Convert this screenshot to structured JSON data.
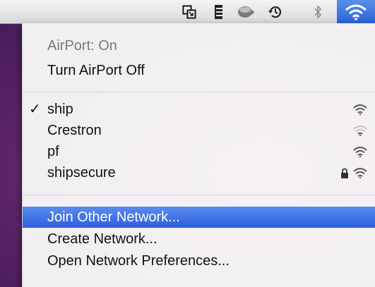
{
  "menubar": {
    "icons": [
      "window-switch-icon",
      "script-icon",
      "coffee-cup-icon",
      "time-machine-icon",
      "bluetooth-icon",
      "wifi-icon"
    ]
  },
  "menu": {
    "status": "AirPort: On",
    "toggle": "Turn AirPort Off",
    "networks": [
      {
        "name": "ship",
        "checked": true,
        "locked": false,
        "signal": "strong"
      },
      {
        "name": "Crestron",
        "checked": false,
        "locked": false,
        "signal": "weak"
      },
      {
        "name": "pf",
        "checked": false,
        "locked": false,
        "signal": "strong"
      },
      {
        "name": "shipsecure",
        "checked": false,
        "locked": true,
        "signal": "strong"
      }
    ],
    "check_mark": "✓",
    "join_other": "Join Other Network...",
    "create": "Create Network...",
    "open_prefs": "Open Network Preferences..."
  },
  "colors": {
    "highlight": "#2c5fdc",
    "active_icon": "#2a64d8"
  }
}
